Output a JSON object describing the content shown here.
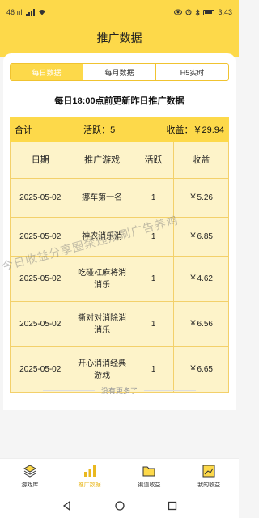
{
  "status_bar": {
    "left_text": "46 ııl",
    "right_text": "3:43",
    "battery": "battery-icon"
  },
  "app_bar": {
    "title": "推广数据"
  },
  "tabs": [
    {
      "label": "每日数据",
      "active": true
    },
    {
      "label": "每月数据",
      "active": false
    },
    {
      "label": "H5实时",
      "active": false
    }
  ],
  "update_note": "每日18:00点前更新昨日推广数据",
  "summary": {
    "total_label": "合计",
    "active_label": "活跃：5",
    "income_label": "收益：￥29.94"
  },
  "table": {
    "headers": [
      "日期",
      "推广游戏",
      "活跃",
      "收益"
    ],
    "rows": [
      {
        "date": "2025-05-02",
        "game": "挪车第一名",
        "active": "1",
        "income": "￥5.26"
      },
      {
        "date": "2025-05-02",
        "game": "神农消乐消",
        "active": "1",
        "income": "￥6.85"
      },
      {
        "date": "2025-05-02",
        "game": "吃碰杠麻将消消乐",
        "active": "1",
        "income": "￥4.62"
      },
      {
        "date": "2025-05-02",
        "game": "撕对对消除消消乐",
        "active": "1",
        "income": "￥6.56"
      },
      {
        "date": "2025-05-02",
        "game": "开心消消经典游戏",
        "active": "1",
        "income": "￥6.65"
      }
    ]
  },
  "no_more": "没有更多了",
  "watermark": "今日收益分享圈禁违规刷广告养鸡",
  "bottom_nav": [
    {
      "label": "游戏库",
      "icon": "layers-icon",
      "active": false
    },
    {
      "label": "推广数据",
      "icon": "bar-chart-icon",
      "active": true
    },
    {
      "label": "渠道收益",
      "icon": "folder-icon",
      "active": false
    },
    {
      "label": "我的收益",
      "icon": "trend-chart-icon",
      "active": false
    }
  ],
  "colors": {
    "accent": "#fdd94a",
    "table_bg": "#fdf3c9",
    "active_nav": "#e9b820"
  }
}
